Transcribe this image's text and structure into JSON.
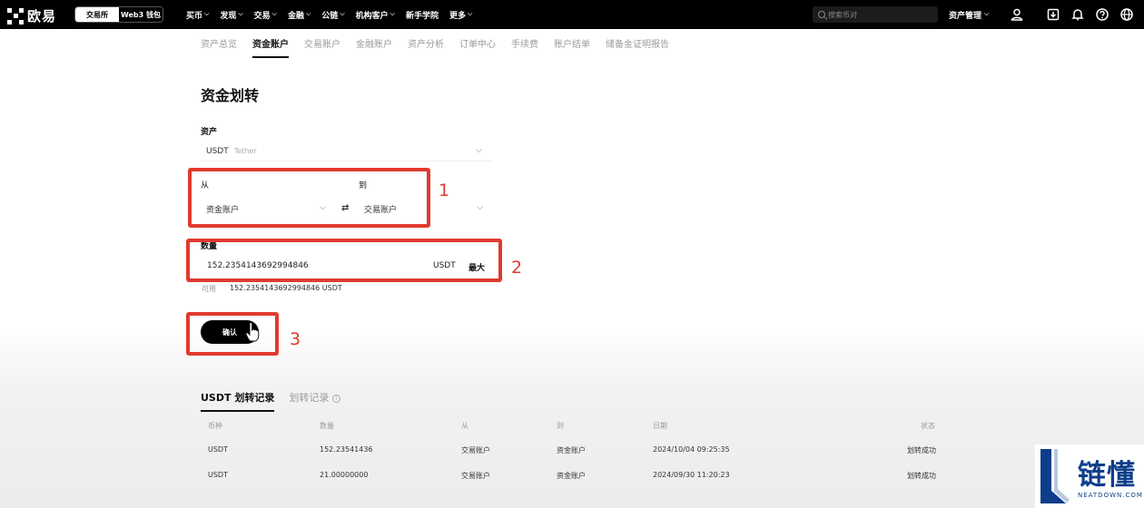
{
  "brand": {
    "name": "欧易"
  },
  "mode_switch": {
    "exchange": "交易所",
    "wallet": "Web3 钱包"
  },
  "nav": {
    "items": [
      {
        "label": "买币",
        "has_chevron": true
      },
      {
        "label": "发现",
        "has_chevron": true
      },
      {
        "label": "交易",
        "has_chevron": true
      },
      {
        "label": "金融",
        "has_chevron": true
      },
      {
        "label": "公链",
        "has_chevron": true
      },
      {
        "label": "机构客户",
        "has_chevron": true
      },
      {
        "label": "新手学院",
        "has_chevron": false
      },
      {
        "label": "更多",
        "has_chevron": true
      }
    ],
    "search_placeholder": "搜索币对",
    "asset_mgmt": "资产管理",
    "icons": [
      "user-icon",
      "download-icon",
      "bell-icon",
      "help-icon",
      "globe-icon"
    ]
  },
  "subtabs": [
    {
      "label": "资产总览",
      "active": false
    },
    {
      "label": "资金账户",
      "active": true
    },
    {
      "label": "交易账户",
      "active": false
    },
    {
      "label": "金融账户",
      "active": false
    },
    {
      "label": "资产分析",
      "active": false
    },
    {
      "label": "订单中心",
      "active": false
    },
    {
      "label": "手续费",
      "active": false
    },
    {
      "label": "账户结单",
      "active": false
    },
    {
      "label": "储备金证明报告",
      "active": false
    }
  ],
  "page_title": "资金划转",
  "form": {
    "asset_label": "资产",
    "asset_code": "USDT",
    "asset_name": "Tether",
    "from_label": "从",
    "from_value": "资金账户",
    "to_label": "到",
    "to_value": "交易账户",
    "quantity_label": "数量",
    "quantity_value": "152.2354143692994846",
    "quantity_unit": "USDT",
    "max_label": "最大",
    "available_label": "可用",
    "available_value": "152.2354143692994846 USDT",
    "confirm_label": "确认"
  },
  "annotations": {
    "box1": "1",
    "box2": "2",
    "box3": "3",
    "color": "#e03a2f"
  },
  "history": {
    "tabs": [
      {
        "label": "USDT 划转记录",
        "active": true
      },
      {
        "label": "划转记录",
        "active": false
      }
    ],
    "columns": [
      "币种",
      "数量",
      "从",
      "到",
      "日期",
      "状态"
    ],
    "rows": [
      [
        "USDT",
        "152.23541436",
        "交易账户",
        "资金账户",
        "2024/10/04 09:25:35",
        "划转成功"
      ],
      [
        "USDT",
        "21.00000000",
        "交易账户",
        "资金账户",
        "2024/09/30 11:20:23",
        "划转成功"
      ]
    ]
  },
  "watermark": {
    "text": "链懂",
    "subtext": "NEATDOWN.COM",
    "color": "#0d3e8a"
  }
}
